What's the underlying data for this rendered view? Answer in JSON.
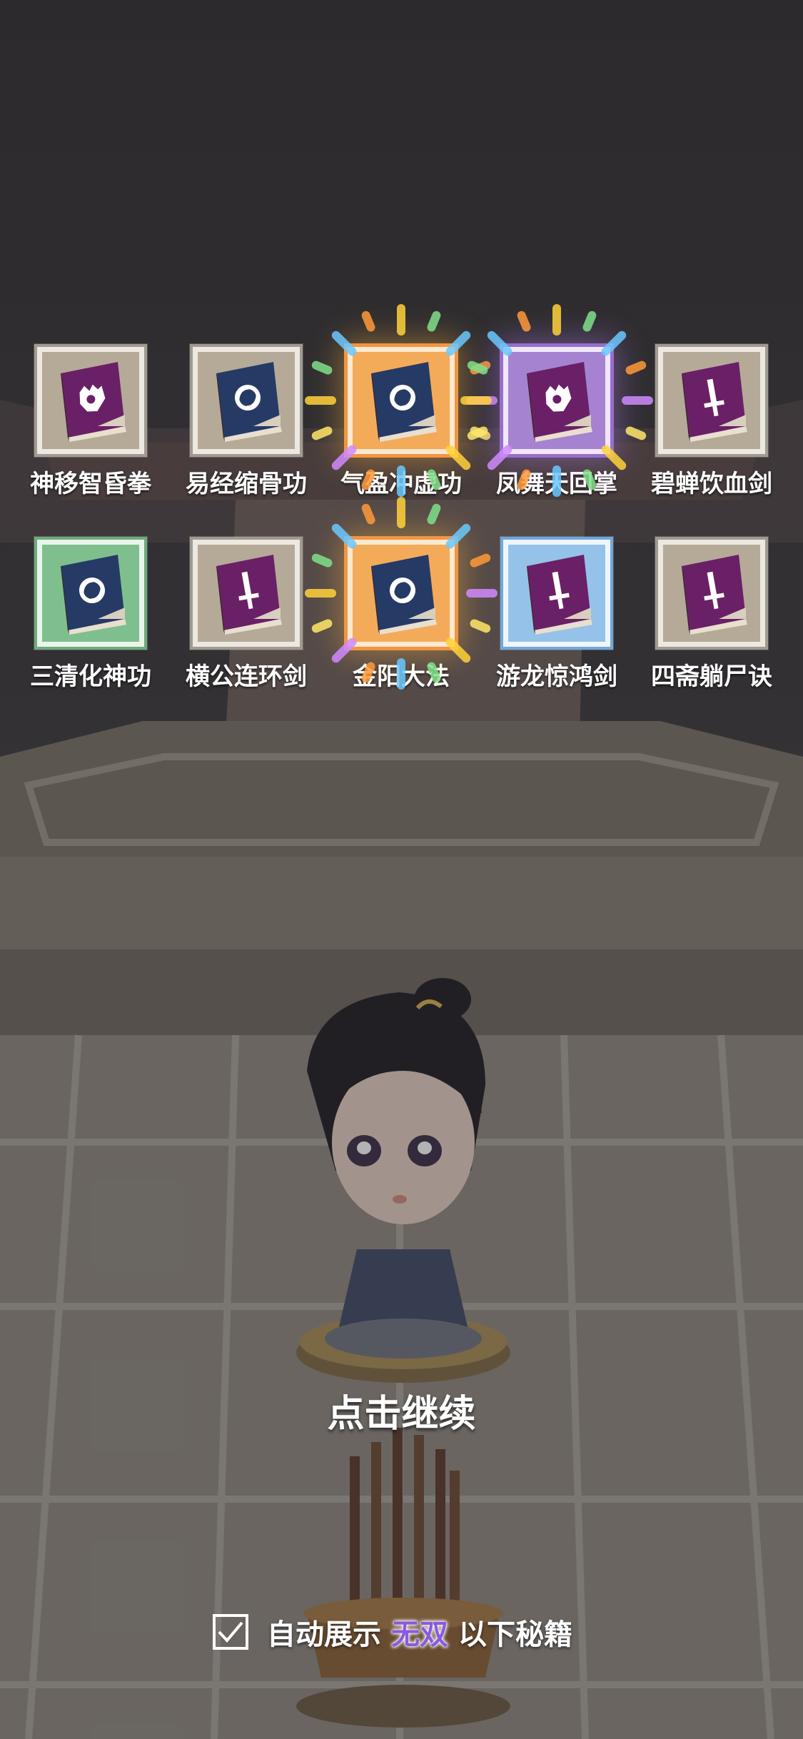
{
  "manuals": [
    {
      "name": "神移智昏拳",
      "rarity": "white",
      "icon": "fist-book-icon",
      "cover": "purple"
    },
    {
      "name": "易经缩骨功",
      "rarity": "white",
      "icon": "swirl-book-icon",
      "cover": "navy"
    },
    {
      "name": "气盈冲虚功",
      "rarity": "orange",
      "icon": "swirl-book-icon",
      "cover": "navy"
    },
    {
      "name": "凤舞天回掌",
      "rarity": "purple",
      "icon": "fist-book-icon",
      "cover": "purple"
    },
    {
      "name": "碧蝉饮血剑",
      "rarity": "white",
      "icon": "sword-book-icon",
      "cover": "purple"
    },
    {
      "name": "三清化神功",
      "rarity": "green",
      "icon": "swirl-book-icon",
      "cover": "navy"
    },
    {
      "name": "横公连环剑",
      "rarity": "white",
      "icon": "sword-book-icon",
      "cover": "purple"
    },
    {
      "name": "金阳大法",
      "rarity": "orange",
      "icon": "swirl-book-icon",
      "cover": "navy"
    },
    {
      "name": "游龙惊鸿剑",
      "rarity": "blue",
      "icon": "sword-book-icon",
      "cover": "purple"
    },
    {
      "name": "四斋躺尸诀",
      "rarity": "white",
      "icon": "sword-book-icon",
      "cover": "purple"
    }
  ],
  "continue_text": "点击继续",
  "auto_show": {
    "checked": true,
    "prefix": "自动展示",
    "rarity_word": "无双",
    "suffix": "以下秘籍"
  },
  "colors": {
    "white": "#b5aa98",
    "green": "#7fbf8e",
    "blue": "#95c2e8",
    "orange": "#f4ab59",
    "purple": "#a583d0",
    "book_purple": "#6a2066",
    "book_navy": "#263a66"
  }
}
